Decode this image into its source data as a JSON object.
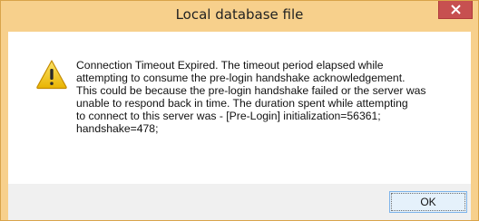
{
  "window": {
    "title": "Local database file"
  },
  "message": {
    "text": "Connection Timeout Expired.  The timeout period elapsed while\nattempting to consume the pre-login handshake acknowledgement.\nThis could be because the pre-login handshake failed or the server was\nunable to respond back in time.  The duration spent while attempting\nto connect to this server was - [Pre-Login] initialization=56361;\nhandshake=478;"
  },
  "buttons": {
    "ok_label": "OK"
  },
  "icons": {
    "warning": "warning-icon",
    "close": "close-icon"
  },
  "colors": {
    "frame": "#f7d08c",
    "close_button": "#c75050",
    "warning_yellow": "#f2c500",
    "ok_button_border": "#7eb4ea"
  }
}
